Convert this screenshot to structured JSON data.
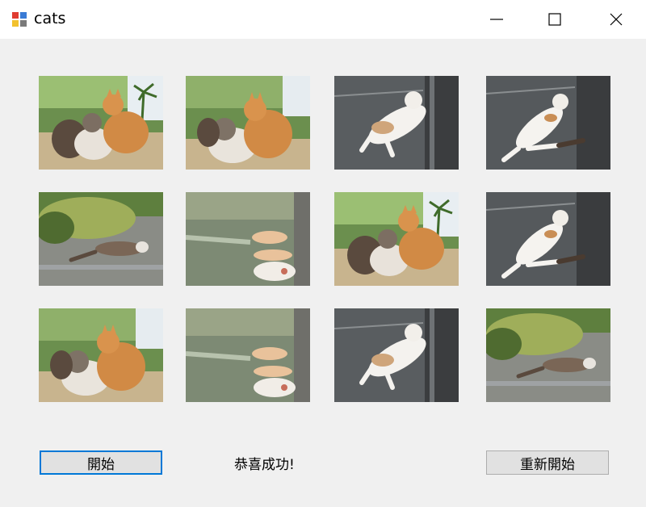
{
  "window": {
    "title": "cats"
  },
  "tiles": [
    {
      "name": "cats-group-trio",
      "scene": "trio"
    },
    {
      "name": "cats-group-pair",
      "scene": "pair"
    },
    {
      "name": "white-cat-on-road",
      "scene": "white-road"
    },
    {
      "name": "white-cat-stretch",
      "scene": "white-stretch"
    },
    {
      "name": "cat-lying-on-grass-road",
      "scene": "grass-road"
    },
    {
      "name": "cat-paws-closeup",
      "scene": "paws"
    },
    {
      "name": "cats-group-trio",
      "scene": "trio"
    },
    {
      "name": "white-cat-stretch",
      "scene": "white-stretch"
    },
    {
      "name": "cats-group-pair",
      "scene": "pair"
    },
    {
      "name": "cat-paws-closeup",
      "scene": "paws"
    },
    {
      "name": "white-cat-on-road",
      "scene": "white-road"
    },
    {
      "name": "cat-lying-on-grass-road",
      "scene": "grass-road"
    }
  ],
  "buttons": {
    "start": "開始",
    "restart": "重新開始"
  },
  "status_message": "恭喜成功!"
}
